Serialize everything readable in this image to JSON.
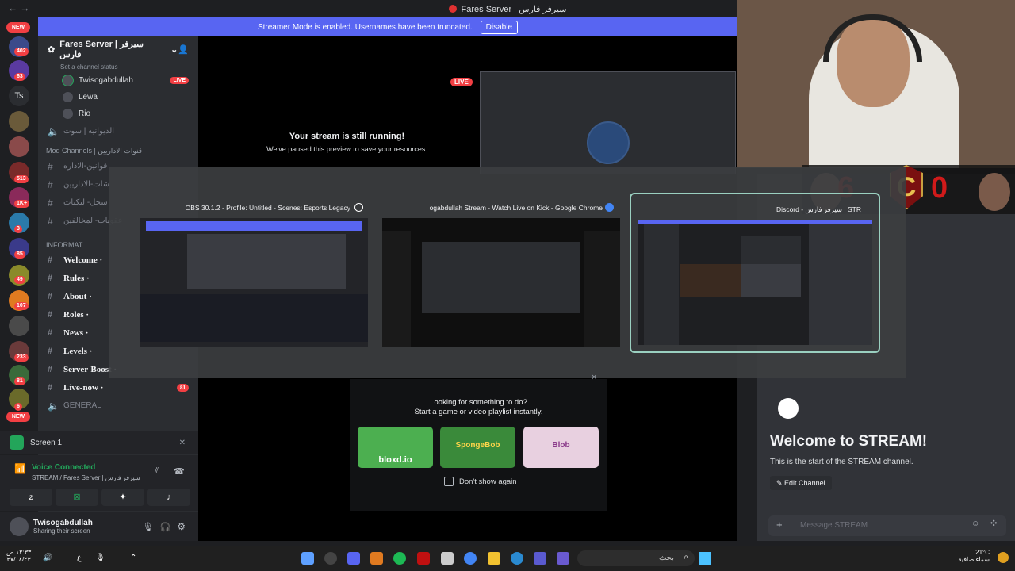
{
  "window": {
    "title": "Fares Server | سيرفر فارس"
  },
  "banner": {
    "text": "Streamer Mode is enabled. Usernames have been truncated.",
    "button": "Disable"
  },
  "rail": {
    "new_top": "NEW",
    "new_bottom": "NEW",
    "badges": [
      "402",
      "63",
      "513",
      "1K+",
      "3",
      "85",
      "49",
      "107",
      "233",
      "81",
      "6"
    ],
    "ts_label": "Ts"
  },
  "sidebar": {
    "server_name": "Fares Server | سيرفر فارس",
    "channel_status": "Set a channel status",
    "voice_users": [
      {
        "name": "Twisogabdullah",
        "live": "LIVE"
      },
      {
        "name": "Lewa"
      },
      {
        "name": "Rio"
      }
    ],
    "voice_channel_2": "الديوانيه | سوت",
    "mod_category": "Mod Channels | قنوات الاداريين",
    "mod_channels": [
      "قوانين-الاداره",
      "شات-الاداريين",
      "سجل-التكتات",
      "عقوبات-المخالفين"
    ],
    "info_category": "INFORMAT",
    "info_channels": [
      "Welcome ·",
      "Rules ·",
      "About ·",
      "Roles ·",
      "News ·",
      "Levels ·",
      "Server-Boost ·",
      "Live-now ·"
    ],
    "live_now_badge": "81",
    "general_channel": "GENERAL"
  },
  "screen_panel": {
    "label": "Screen 1"
  },
  "voice_panel": {
    "status": "Voice Connected",
    "channel": "STREAM / Fares Server | سيرفر فارس"
  },
  "user_panel": {
    "name": "Twisogabdullah",
    "status": "Sharing their screen"
  },
  "stage": {
    "live": "LIVE",
    "paused_title": "Your stream is still running!",
    "paused_sub": "We've paused this preview to save your resources."
  },
  "alttab": {
    "windows": [
      {
        "title": "OBS 30.1.2 - Profile: Untitled - Scenes: Esports Legacy"
      },
      {
        "title": "ogabdullah Stream - Watch Live on Kick - Google Chrome"
      },
      {
        "title": "Discord - سيرفر فارس | STR"
      }
    ]
  },
  "activity": {
    "headline": "Looking for something to do?",
    "sub": "Start a game or video playlist instantly.",
    "games": [
      "bloxd.io",
      "SpongeBob",
      "Blob"
    ],
    "dont_show": "Don't show again"
  },
  "chat": {
    "welcome": "Welcome to STREAM!",
    "start": "This is the start of the STREAM channel.",
    "edit_button": "Edit Channel",
    "placeholder": "Message STREAM"
  },
  "scoreboard": {
    "left": "6",
    "right": "0",
    "logo": "C"
  },
  "taskbar": {
    "left_time": "١٢:٣٣ ص",
    "left_date": "٢٧/٠٨/٢٣",
    "lang": "ع",
    "search": "بحث",
    "weather_temp": "21°C",
    "weather_desc": "سماء صافية"
  }
}
